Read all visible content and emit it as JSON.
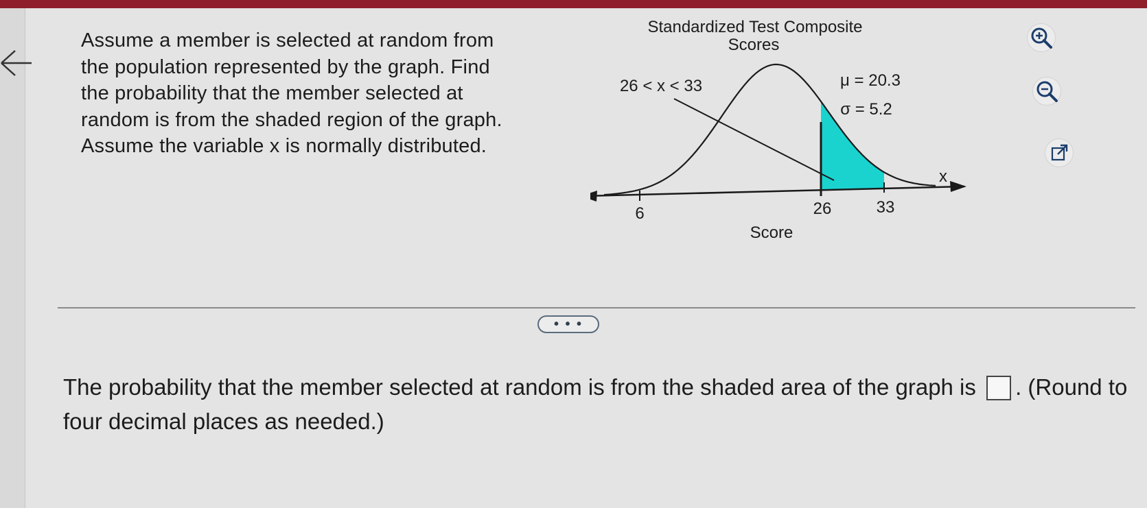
{
  "question": {
    "text": "Assume a member is selected at random from the population represented by the graph. Find the probability that the member selected at random is from the shaded region of the graph. Assume the variable x is normally distributed."
  },
  "graph": {
    "title_line1": "Standardized Test Composite",
    "title_line2": "Scores",
    "interval_label": "26 < x < 33",
    "mu_label": "μ = 20.3",
    "sigma_label": "σ = 5.2",
    "axis_var": "x",
    "ticks": [
      "6",
      "26",
      "33"
    ],
    "xlabel": "Score",
    "shade_color": "#1ad3cf"
  },
  "tools": {
    "zoom_in": "zoom-in-icon",
    "zoom_out": "zoom-out-icon",
    "popout": "external-link-icon"
  },
  "expander_label": "• • •",
  "answer": {
    "prefix": "The probability that the member selected at random is from the shaded area of the graph is",
    "suffix": ". (Round to four decimal places as needed.)"
  }
}
